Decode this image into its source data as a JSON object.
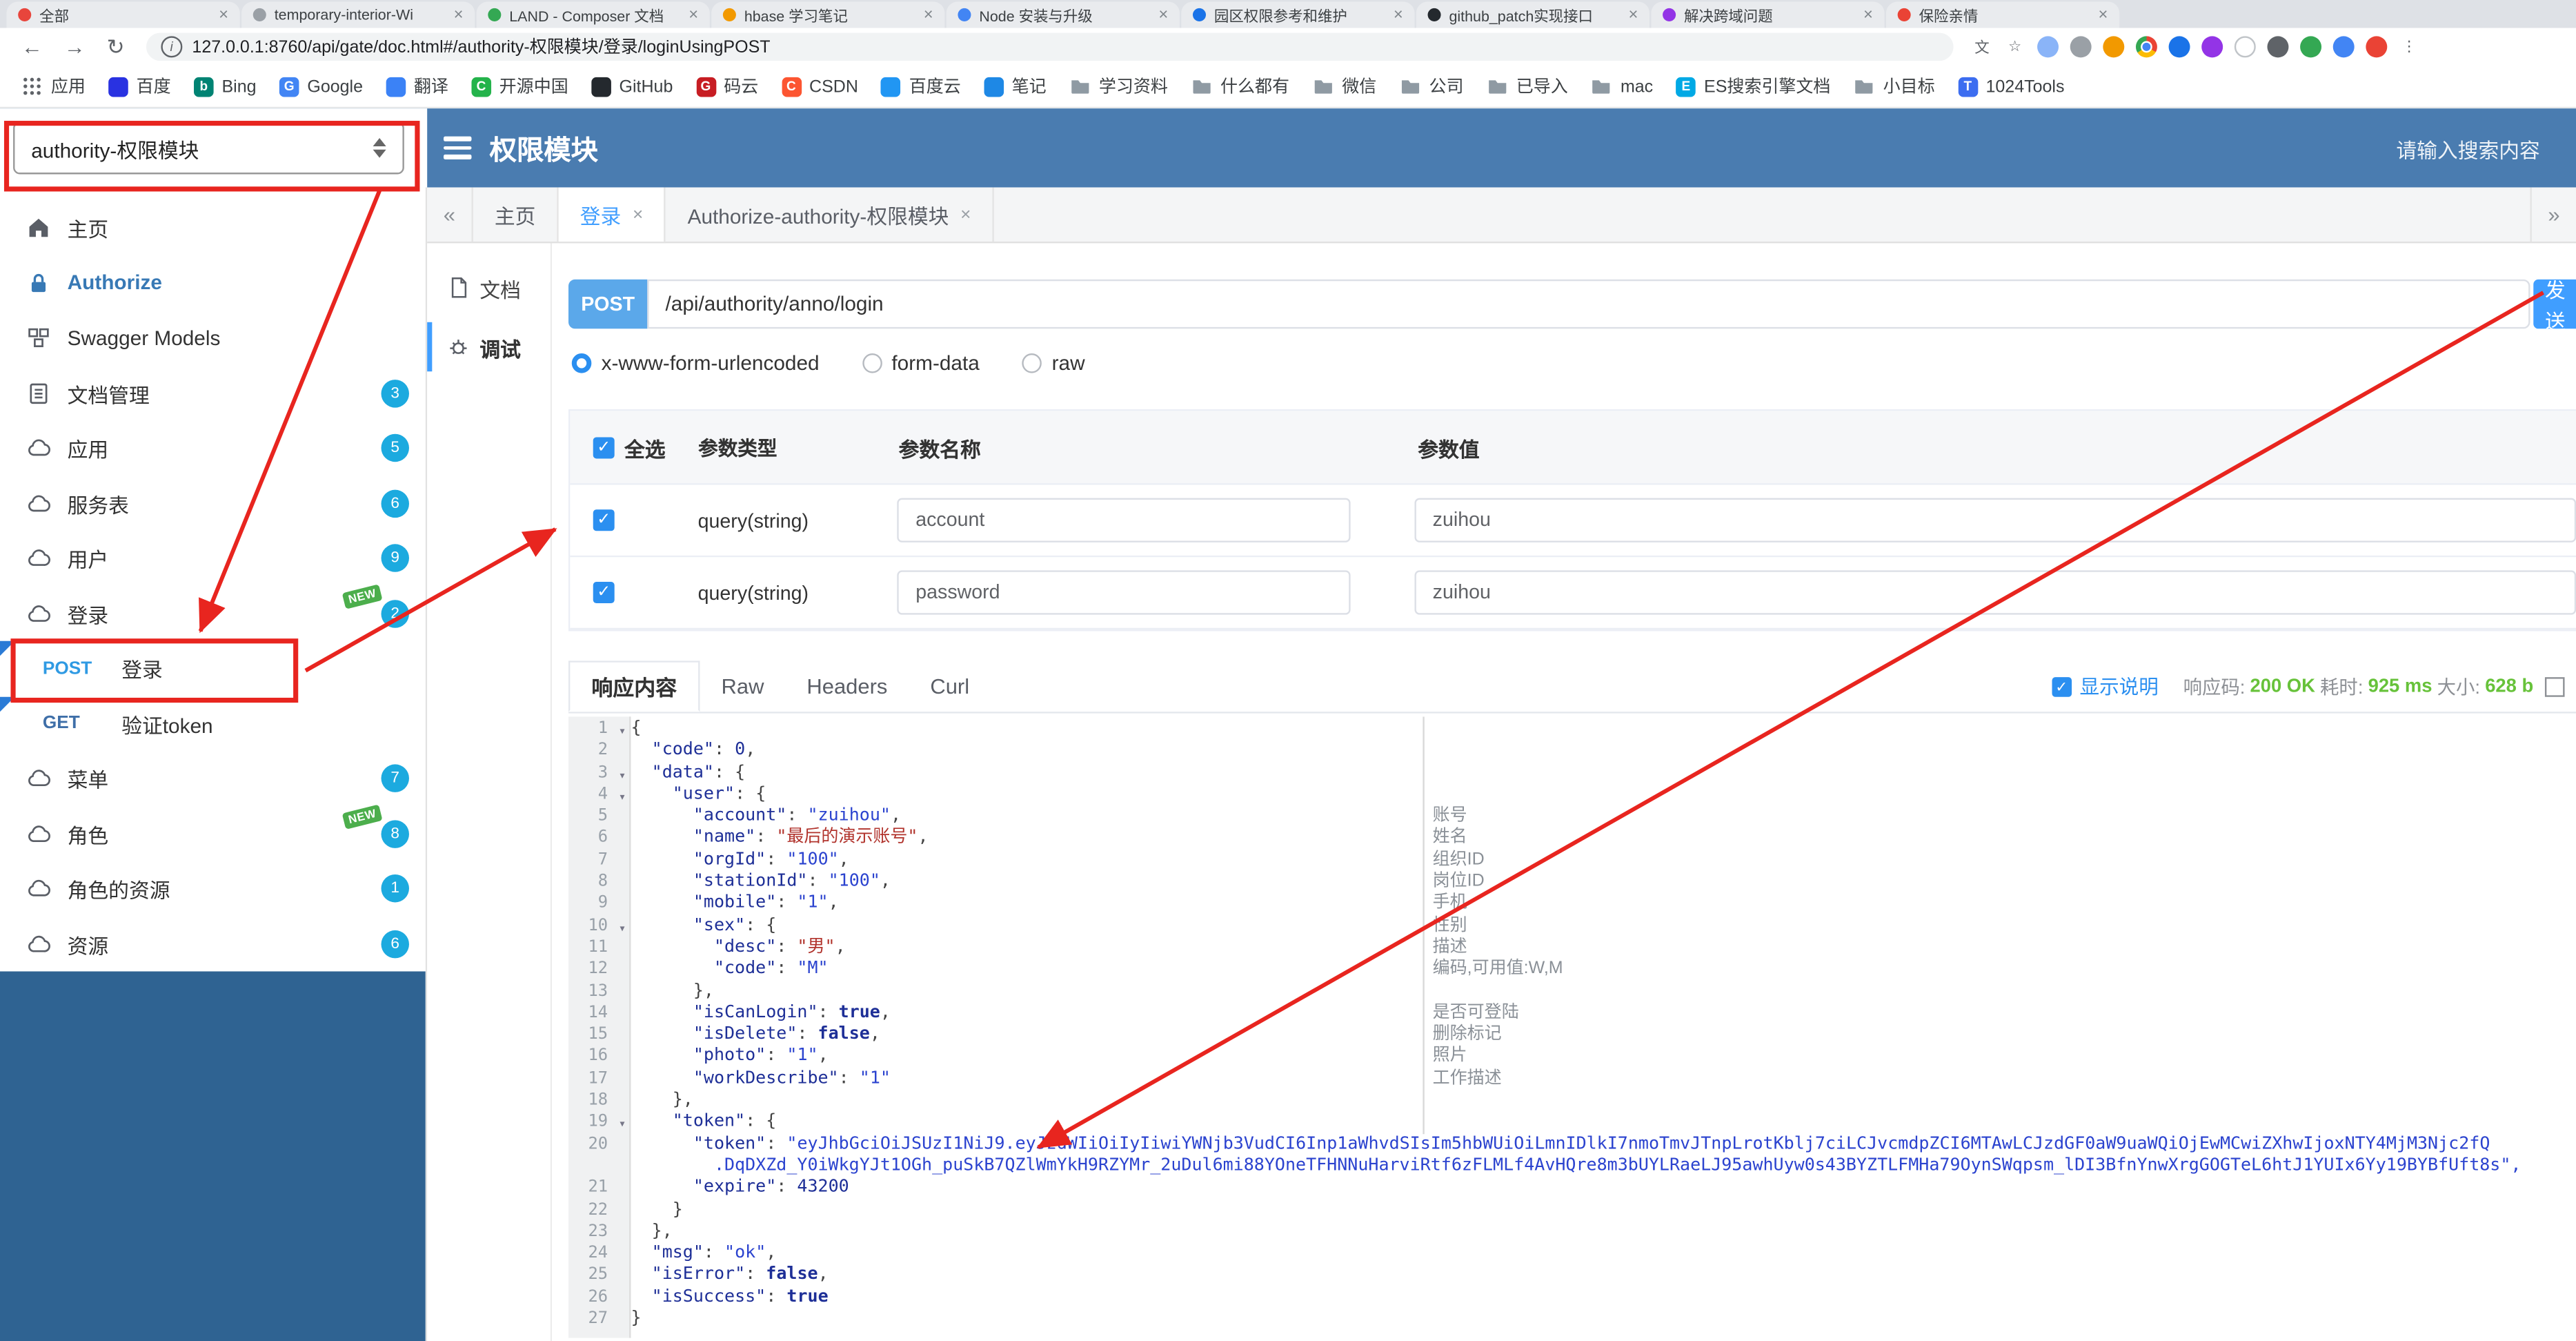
{
  "colors": {
    "header_bg": "#4a7cb0",
    "sidebar_dark_bg": "#2f6392",
    "accent_blue": "#409eff",
    "method_badge_bg": "#5ba8ea",
    "badge_bg": "#1caadf",
    "new_tag_bg": "#4cae4c",
    "success_green": "#67c23a",
    "annotation_red": "#e8251f"
  },
  "browser": {
    "tabs": [
      {
        "title": "全部",
        "favicon_color": "#e8453c"
      },
      {
        "title": "temporary-interior-Wi",
        "favicon_color": "#9aa0a6"
      },
      {
        "title": "LAND - Composer 文档",
        "favicon_color": "#34a853"
      },
      {
        "title": "hbase 学习笔记",
        "favicon_color": "#f29900"
      },
      {
        "title": "Node 安装与升级",
        "favicon_color": "#4285f4"
      },
      {
        "title": "园区权限参考和维护",
        "favicon_color": "#1a73e8"
      },
      {
        "title": "github_patch实现接口",
        "favicon_color": "#24292e"
      },
      {
        "title": "解决跨域问题",
        "favicon_color": "#9334e6"
      },
      {
        "title": "保险亲情",
        "favicon_color": "#ea4335"
      }
    ],
    "address": {
      "url": "127.0.0.1:8760/api/gate/doc.html#/authority-权限模块/登录/loginUsingPOST"
    },
    "toolbar_icons": [
      {
        "name": "translate-icon",
        "glyph": "文"
      },
      {
        "name": "bookmark-star-icon",
        "glyph": "☆"
      },
      {
        "name": "extension-icon-1",
        "bg": "#8ab4f8"
      },
      {
        "name": "extension-icon-2",
        "bg": "#9aa0a6"
      },
      {
        "name": "extension-icon-3",
        "bg": "#f29900"
      },
      {
        "name": "chrome-icon",
        "chrome": true
      },
      {
        "name": "extension-icon-4",
        "bg": "#1a73e8"
      },
      {
        "name": "extension-icon-5",
        "bg": "#9334e6"
      },
      {
        "name": "extension-icon-6",
        "bg": "#ffffff",
        "ring": "#c0c4c8"
      },
      {
        "name": "shield-icon",
        "bg": "#5f6368"
      },
      {
        "name": "extension-icon-7",
        "bg": "#34a853"
      },
      {
        "name": "extension-icon-8",
        "bg": "#4285f4"
      },
      {
        "name": "avatar-icon",
        "bg": "#ea4335"
      },
      {
        "name": "menu-dots-icon",
        "glyph": "⋮"
      }
    ],
    "bookmarks": [
      {
        "label": "应用",
        "icon": "apps"
      },
      {
        "label": "百度",
        "icon": "site",
        "color": "#2932e1"
      },
      {
        "label": "Bing",
        "icon": "site",
        "color": "#008373",
        "letter": "b"
      },
      {
        "label": "Google",
        "icon": "site",
        "color": "#4285f4",
        "letter": "G"
      },
      {
        "label": "翻译",
        "icon": "site",
        "color": "#3b82f6"
      },
      {
        "label": "开源中国",
        "icon": "site",
        "color": "#24b34b",
        "letter": "C"
      },
      {
        "label": "GitHub",
        "icon": "site",
        "color": "#24292e"
      },
      {
        "label": "码云",
        "icon": "site",
        "color": "#c71d23",
        "letter": "G"
      },
      {
        "label": "CSDN",
        "icon": "site",
        "color": "#fc5531",
        "letter": "C"
      },
      {
        "label": "百度云",
        "icon": "site",
        "color": "#2196f3"
      },
      {
        "label": "笔记",
        "icon": "site",
        "color": "#1e88e5"
      },
      {
        "label": "学习资料",
        "icon": "folder"
      },
      {
        "label": "什么都有",
        "icon": "folder"
      },
      {
        "label": "微信",
        "icon": "folder"
      },
      {
        "label": "公司",
        "icon": "folder"
      },
      {
        "label": "已导入",
        "icon": "folder"
      },
      {
        "label": "mac",
        "icon": "folder"
      },
      {
        "label": "ES搜索引擎文档",
        "icon": "site",
        "color": "#00a9e5",
        "letter": "E"
      },
      {
        "label": "小目标",
        "icon": "folder"
      },
      {
        "label": "1024Tools",
        "icon": "site",
        "color": "#3c6df0",
        "letter": "T"
      }
    ]
  },
  "header": {
    "module_select": "authority-权限模块",
    "title": "权限模块",
    "search_placeholder": "请输入搜索内容"
  },
  "sidebar": {
    "items": [
      {
        "type": "item",
        "label": "主页",
        "icon": "home"
      },
      {
        "type": "item",
        "label": "Authorize",
        "icon": "lock",
        "accent": true
      },
      {
        "type": "item",
        "label": "Swagger Models",
        "icon": "models"
      },
      {
        "type": "group",
        "label": "文档管理",
        "icon": "doc",
        "badge": 3
      },
      {
        "type": "group",
        "label": "应用",
        "icon": "cloud",
        "badge": 5
      },
      {
        "type": "group",
        "label": "服务表",
        "icon": "cloud",
        "badge": 6
      },
      {
        "type": "group",
        "label": "用户",
        "icon": "cloud",
        "badge": 9
      },
      {
        "type": "group",
        "label": "登录",
        "icon": "cloud",
        "badge": 2,
        "new": true
      },
      {
        "type": "api",
        "method": "POST",
        "label": "登录",
        "flag": true,
        "selected": true
      },
      {
        "type": "api",
        "method": "GET",
        "label": "验证token",
        "flag": true
      },
      {
        "type": "group",
        "label": "菜单",
        "icon": "cloud",
        "badge": 7
      },
      {
        "type": "group",
        "label": "角色",
        "icon": "cloud",
        "badge": 8,
        "new": true
      },
      {
        "type": "group",
        "label": "角色的资源",
        "icon": "cloud",
        "badge": 1
      },
      {
        "type": "group",
        "label": "资源",
        "icon": "cloud",
        "badge": 6
      }
    ]
  },
  "page_tabs": {
    "scroll_left": "«",
    "scroll_right": "»",
    "items": [
      {
        "label": "主页",
        "closable": false,
        "active": false
      },
      {
        "label": "登录",
        "closable": true,
        "active": true
      },
      {
        "label": "Authorize-authority-权限模块",
        "closable": true,
        "active": false
      }
    ]
  },
  "doc_tabs": [
    {
      "label": "文档",
      "icon": "docpage",
      "active": false
    },
    {
      "label": "调试",
      "icon": "debug",
      "active": true
    }
  ],
  "request": {
    "method": "POST",
    "url": "/api/authority/anno/login",
    "send_label": "发送",
    "content_types": [
      {
        "label": "x-www-form-urlencoded",
        "selected": true
      },
      {
        "label": "form-data",
        "selected": false
      },
      {
        "label": "raw",
        "selected": false
      }
    ]
  },
  "params_table": {
    "select_all_label": "全选",
    "headers": [
      "参数类型",
      "参数名称",
      "参数值"
    ],
    "rows": [
      {
        "checked": true,
        "type": "query(string)",
        "name": "account",
        "value": "zuihou"
      },
      {
        "checked": true,
        "type": "query(string)",
        "name": "password",
        "value": "zuihou"
      }
    ]
  },
  "response": {
    "tabs": [
      "响应内容",
      "Raw",
      "Headers",
      "Curl"
    ],
    "active_tab": "响应内容",
    "show_desc_label": "显示说明",
    "show_desc_checked": true,
    "meta": [
      {
        "label": "响应码:",
        "value": "200 OK"
      },
      {
        "label": "耗时:",
        "value": "925 ms"
      },
      {
        "label": "大小:",
        "value": "628 b"
      }
    ]
  },
  "editor": {
    "fold_lines": [
      1,
      3,
      4,
      10,
      19
    ],
    "comments": {
      "5": "账号",
      "6": "姓名",
      "7": "组织ID",
      "8": "岗位ID",
      "9": "手机",
      "10": "性别",
      "11": "描述",
      "12": "编码,可用值:W,M",
      "14": "是否可登陆",
      "15": "删除标记",
      "16": "照片",
      "17": "工作描述"
    },
    "rows": [
      {
        "n": 1,
        "t": "{"
      },
      {
        "n": 2,
        "t": "  \"code\": 0,"
      },
      {
        "n": 3,
        "t": "  \"data\": {"
      },
      {
        "n": 4,
        "t": "    \"user\": {"
      },
      {
        "n": 5,
        "t": "      \"account\": \"zuihou\","
      },
      {
        "n": 6,
        "t": "      \"name\": \"最后的演示账号\","
      },
      {
        "n": 7,
        "t": "      \"orgId\": \"100\","
      },
      {
        "n": 8,
        "t": "      \"stationId\": \"100\","
      },
      {
        "n": 9,
        "t": "      \"mobile\": \"1\","
      },
      {
        "n": 10,
        "t": "      \"sex\": {"
      },
      {
        "n": 11,
        "t": "        \"desc\": \"男\","
      },
      {
        "n": 12,
        "t": "        \"code\": \"M\""
      },
      {
        "n": 13,
        "t": "      },"
      },
      {
        "n": 14,
        "t": "      \"isCanLogin\": true,"
      },
      {
        "n": 15,
        "t": "      \"isDelete\": false,"
      },
      {
        "n": 16,
        "t": "      \"photo\": \"1\","
      },
      {
        "n": 17,
        "t": "      \"workDescribe\": \"1\""
      },
      {
        "n": 18,
        "t": "    },"
      },
      {
        "n": 19,
        "t": "    \"token\": {"
      },
      {
        "n": 20,
        "t": "      \"token\": \"eyJhbGciOiJSUzI1NiJ9.eyJzdWIiOiIyIiwiYWNjb3VudCI6Inp1aWhvdSIsIm5hbWUiOiLmnIDlkI7nmoTmvJTnpLrotKblj7ciLCJvcmdpZCI6MTAwLCJzdGF0aW9uaWQiOjEwMCwiZXhwIjoxNTY4MjM3Njc2fQ"
      },
      {
        "n": null,
        "cont": true,
        "t": "        .DqDXZd_Y0iWkgYJt1OGh_puSkB7QZlWmYkH9RZYMr_2uDul6mi88YOneTFHNNuHarviRtf6zFLMLf4AvHQre8m3bUYLRaeLJ95awhUyw0s43BYZTLFMHa79OynSWqpsm_lDI3BfnYnwXrgGOGTeL6htJ1YUIx6Yy19BYBfUft8s\","
      },
      {
        "n": 21,
        "t": "      \"expire\": 43200"
      },
      {
        "n": 22,
        "t": "    }"
      },
      {
        "n": 23,
        "t": "  },"
      },
      {
        "n": 24,
        "t": "  \"msg\": \"ok\","
      },
      {
        "n": 25,
        "t": "  \"isError\": false,"
      },
      {
        "n": 26,
        "t": "  \"isSuccess\": true"
      },
      {
        "n": 27,
        "t": "}"
      }
    ]
  }
}
